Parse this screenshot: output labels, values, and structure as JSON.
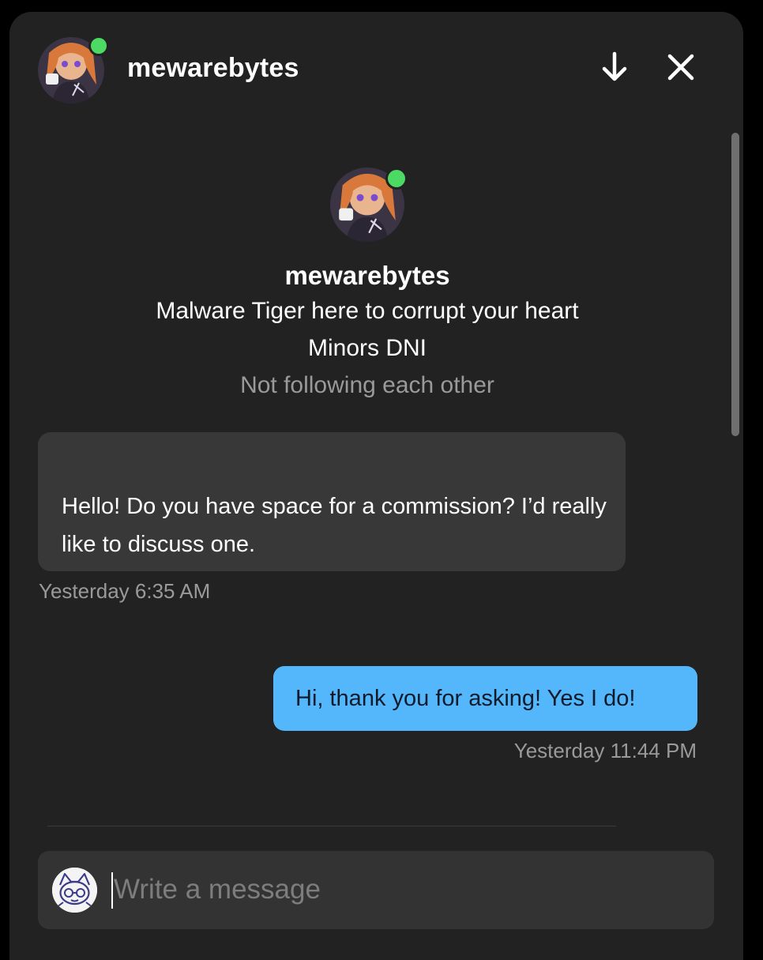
{
  "header": {
    "username": "mewarebytes",
    "download_icon": "arrow-down-icon",
    "close_icon": "close-icon"
  },
  "profile": {
    "username": "mewarebytes",
    "bio_line_1": "Malware Tiger here to corrupt your heart",
    "bio_line_2": "Minors DNI",
    "follow_status": "Not following each other"
  },
  "messages": [
    {
      "direction": "incoming",
      "text": "Hello! Do you have space for a commission? I’d really like to discuss one.",
      "timestamp": "Yesterday 6:35 AM"
    },
    {
      "direction": "outgoing",
      "text": "Hi, thank you for asking! Yes I do!",
      "timestamp": "Yesterday 11:44 PM"
    }
  ],
  "composer": {
    "placeholder": "Write a message"
  },
  "colors": {
    "background": "#222222",
    "incoming_bubble": "#383838",
    "outgoing_bubble": "#55b7fb",
    "online_dot": "#4cd964",
    "muted_text": "#9a9a9a"
  }
}
